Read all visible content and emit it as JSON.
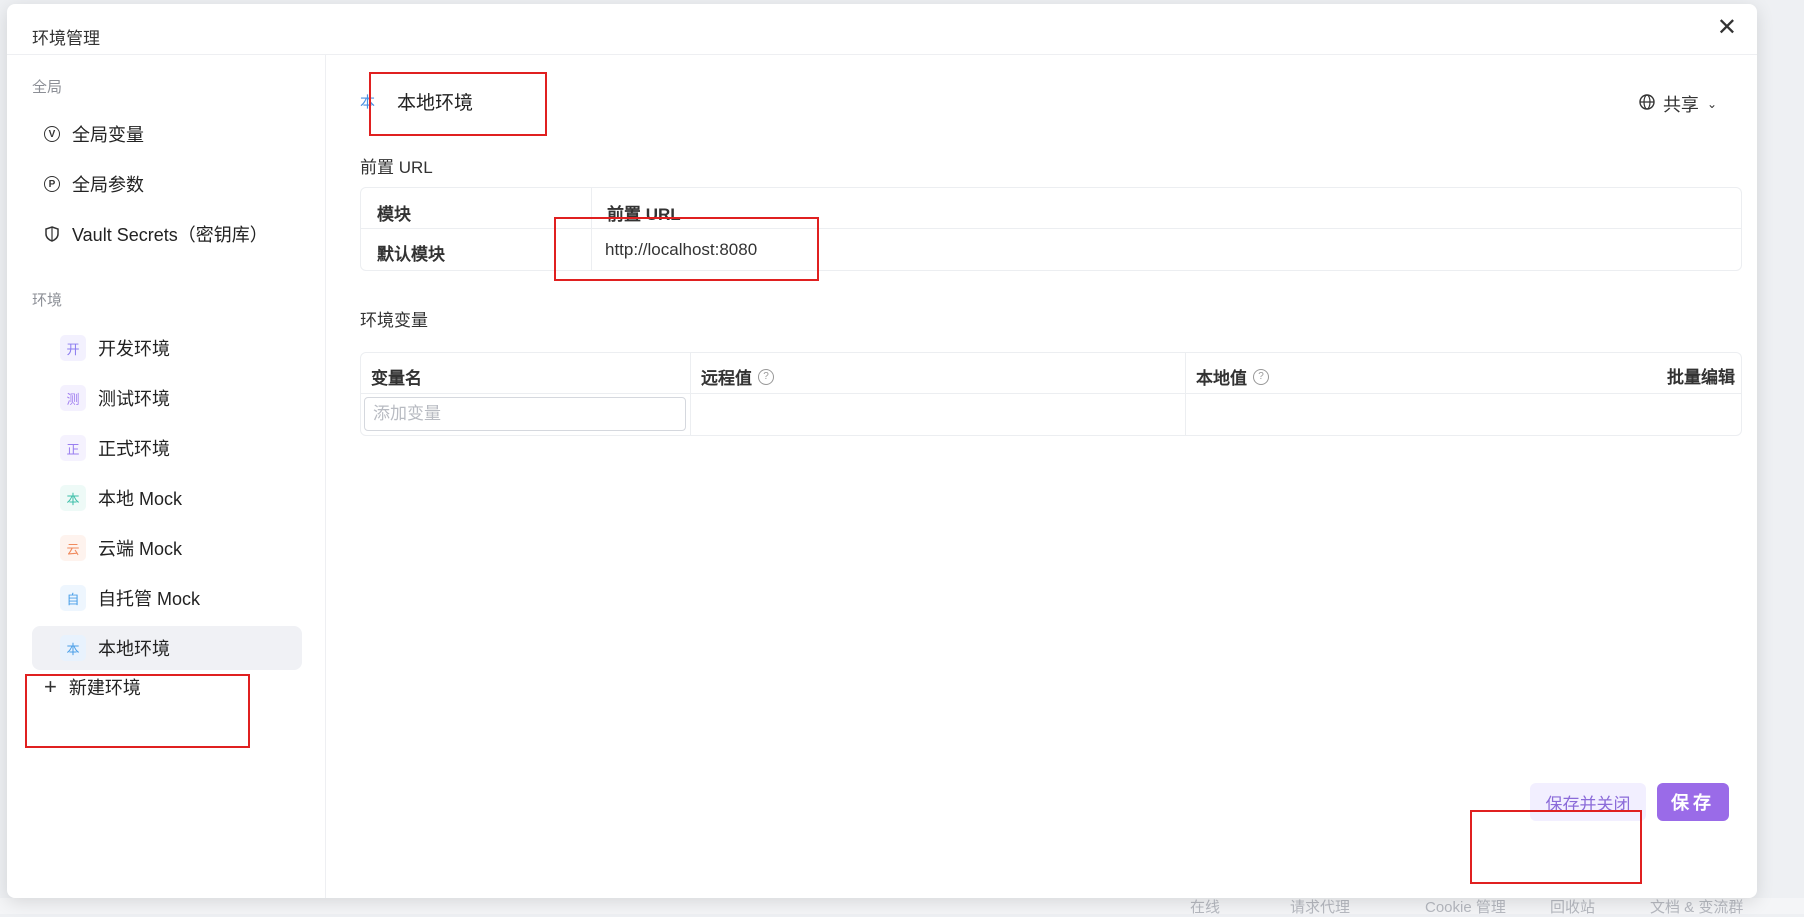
{
  "background": {
    "status_bar": [
      "在线",
      "请求代理",
      "Cookie 管理",
      "回收站",
      "文档 & 变流群"
    ]
  },
  "modal": {
    "title": "环境管理",
    "close": "✕"
  },
  "sidebar": {
    "global_label": "全局",
    "global_items": [
      {
        "icon": "V",
        "label": "全局变量"
      },
      {
        "icon": "P",
        "label": "全局参数"
      },
      {
        "icon": "shield-icon",
        "label": "Vault Secrets（密钥库）"
      }
    ],
    "env_label": "环境",
    "environments": [
      {
        "badge": "开",
        "label": "开发环境",
        "color": "#8b7cf0",
        "bg": "#f3f1fe"
      },
      {
        "badge": "测",
        "label": "测试环境",
        "color": "#a07ef0",
        "bg": "#f4f1fe"
      },
      {
        "badge": "正",
        "label": "正式环境",
        "color": "#9a7ff0",
        "bg": "#f5f2fe"
      },
      {
        "badge": "本",
        "label": "本地 Mock",
        "color": "#3cbfa8",
        "bg": "#eefaf7"
      },
      {
        "badge": "云",
        "label": "云端 Mock",
        "color": "#f08a5d",
        "bg": "#fef3ee"
      },
      {
        "badge": "自",
        "label": "自托管 Mock",
        "color": "#4a9fe8",
        "bg": "#eef6fe"
      },
      {
        "badge": "本",
        "label": "本地环境",
        "color": "#4a9fe8",
        "bg": "#e8f2fd",
        "active": true
      }
    ],
    "new_env_label": "新建环境"
  },
  "main": {
    "env_badge": "本",
    "env_name": "本地环境",
    "share_label": "共享",
    "prefix_url_heading": "前置 URL",
    "prefix_table": {
      "headers": [
        "模块",
        "前置 URL"
      ],
      "rows": [
        [
          "默认模块",
          "http://localhost:8080"
        ]
      ]
    },
    "env_vars_heading": "环境变量",
    "vars_table": {
      "headers": [
        "变量名",
        "远程值",
        "本地值"
      ],
      "batch_edit": "批量编辑",
      "add_placeholder": "添加变量"
    }
  },
  "footer": {
    "save_close": "保存并关闭",
    "save": "保存"
  },
  "colors": {
    "primary": "#9a6be8",
    "primary_light": "#f2efff",
    "highlight": "#e02020"
  }
}
